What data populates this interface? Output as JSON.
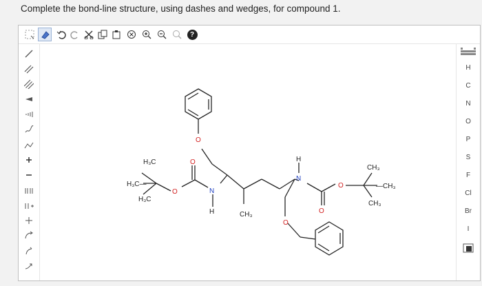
{
  "instruction": "Complete the bond-line structure, using dashes and wedges, for compound 1.",
  "toolbar": {
    "help_label": "?"
  },
  "elements": [
    "H",
    "C",
    "N",
    "O",
    "P",
    "S",
    "F",
    "Cl",
    "Br",
    "I"
  ],
  "molecule": {
    "labels": {
      "h3c_top": "H₃C",
      "h3c_mid": "H₃C—",
      "h3c_bot": "H₃C",
      "o_carbonyl_left": "O",
      "o_ester_left": "O",
      "o_phenyl_top": "O",
      "n_left": "N",
      "h_left": "H",
      "ch3_center": "CH₃",
      "n_right": "N",
      "h_right": "H",
      "o_ester_right": "O",
      "o_carbonyl_right": "O",
      "ch3_tr_top": "CH₃",
      "ch3_tr_right": "—CH₃",
      "ch3_tr_bot": "CH₃",
      "o_phenyl_bot": "O"
    }
  }
}
